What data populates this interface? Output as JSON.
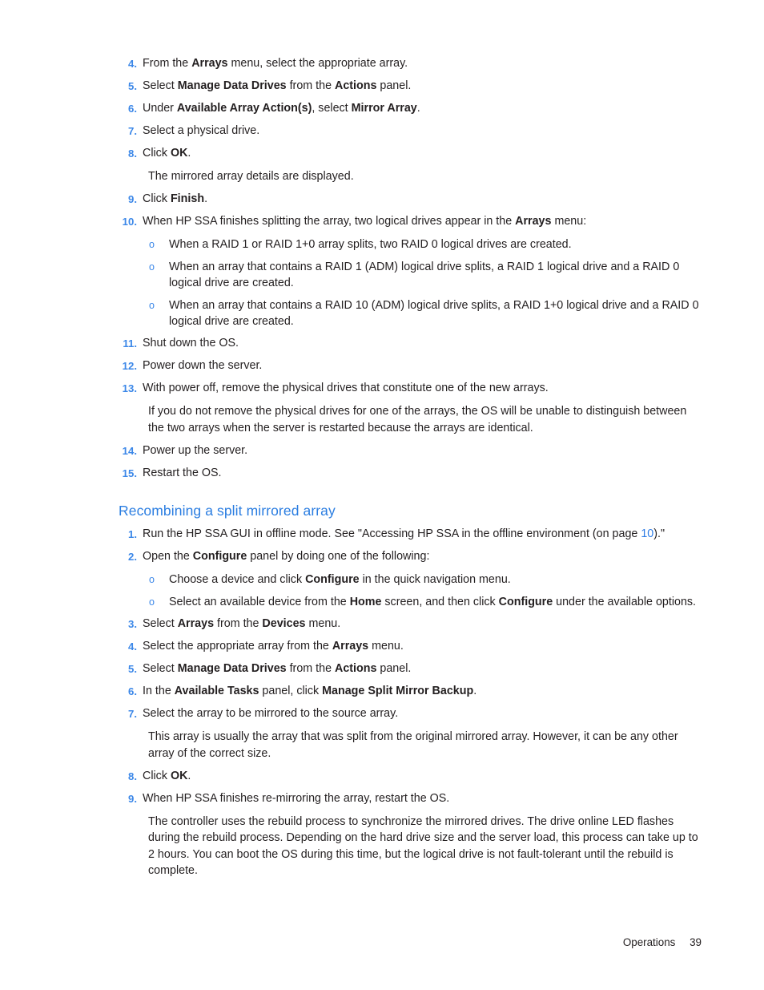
{
  "document": {
    "footer": {
      "chapter": "Operations",
      "page_number": "39"
    },
    "colors": {
      "list_marker": "#3b87e8",
      "heading": "#2a7de1",
      "body_text": "#231f20",
      "cross_reference": "#2c7be5"
    }
  },
  "list_one": {
    "items": [
      {
        "num": "4.",
        "text_html": "From the <b>Arrays</b> menu, select the appropriate array."
      },
      {
        "num": "5.",
        "text_html": "Select <b>Manage Data Drives</b> from the <b>Actions</b> panel."
      },
      {
        "num": "6.",
        "text_html": "Under <b>Available Array Action(s)</b>, select <b>Mirror Array</b>."
      },
      {
        "num": "7.",
        "text_html": "Select a physical drive."
      },
      {
        "num": "8.",
        "text_html": "Click <b>OK</b>."
      },
      {
        "num": "9.",
        "text_html": "Click <b>Finish</b>."
      },
      {
        "num": "10.",
        "text_html": "When HP SSA finishes splitting the array, two logical drives appear in the <b>Arrays</b> menu:"
      },
      {
        "num": "11.",
        "text_html": "Shut down the OS."
      },
      {
        "num": "12.",
        "text_html": "Power down the server."
      },
      {
        "num": "13.",
        "text_html": "With power off, remove the physical drives that constitute one of the new arrays."
      },
      {
        "num": "14.",
        "text_html": "Power up the server."
      },
      {
        "num": "15.",
        "text_html": "Restart the OS."
      }
    ],
    "after_step_8_note": "The mirrored array details are displayed.",
    "step_10_subitems": [
      "When a RAID 1 or RAID 1+0 array splits, two RAID 0 logical drives are created.",
      "When an array that contains a RAID 1 (ADM) logical drive splits, a RAID 1 logical drive and a RAID 0 logical drive are created.",
      "When an array that contains a RAID 10 (ADM) logical drive splits, a RAID 1+0 logical drive and a RAID 0 logical drive are created."
    ],
    "after_step_13_note": "If you do not remove the physical drives for one of the arrays, the OS will be unable to distinguish between the two arrays when the server is restarted because the arrays are identical."
  },
  "section": {
    "heading": "Recombining a split mirrored array",
    "items": [
      {
        "num": "1.",
        "text_html": "Run the HP SSA GUI in offline mode. See \"Accessing HP SSA in the offline environment (on page <span class=\"xref\">10</span>).\""
      },
      {
        "num": "2.",
        "text_html": "Open the <b>Configure</b> panel by doing one of the following:"
      },
      {
        "num": "3.",
        "text_html": "Select <b>Arrays</b> from the <b>Devices</b> menu."
      },
      {
        "num": "4.",
        "text_html": "Select the appropriate array from the <b>Arrays</b> menu."
      },
      {
        "num": "5.",
        "text_html": "Select <b>Manage Data Drives</b> from the <b>Actions</b> panel."
      },
      {
        "num": "6.",
        "text_html": "In the <b>Available Tasks</b> panel, click <b>Manage Split Mirror Backup</b>."
      },
      {
        "num": "7.",
        "text_html": "Select the array to be mirrored to the source array."
      },
      {
        "num": "8.",
        "text_html": "Click <b>OK</b>."
      },
      {
        "num": "9.",
        "text_html": "When HP SSA finishes re-mirroring the array, restart the OS."
      }
    ],
    "step_2_subitems": [
      "Choose a device and click <b>Configure</b> in the quick navigation menu.",
      "Select an available device from the <b>Home</b> screen, and then click <b>Configure</b> under the available options."
    ],
    "after_step_7_note": "This array is usually the array that was split from the original mirrored array. However, it can be any other array of the correct size.",
    "after_step_9_note": "The controller uses the rebuild process to synchronize the mirrored drives. The drive online LED flashes during the rebuild process. Depending on the hard drive size and the server load, this process can take up to 2 hours. You can boot the OS during this time, but the logical drive is not fault-tolerant until the rebuild is complete."
  },
  "sub_bullet_marker": "o"
}
